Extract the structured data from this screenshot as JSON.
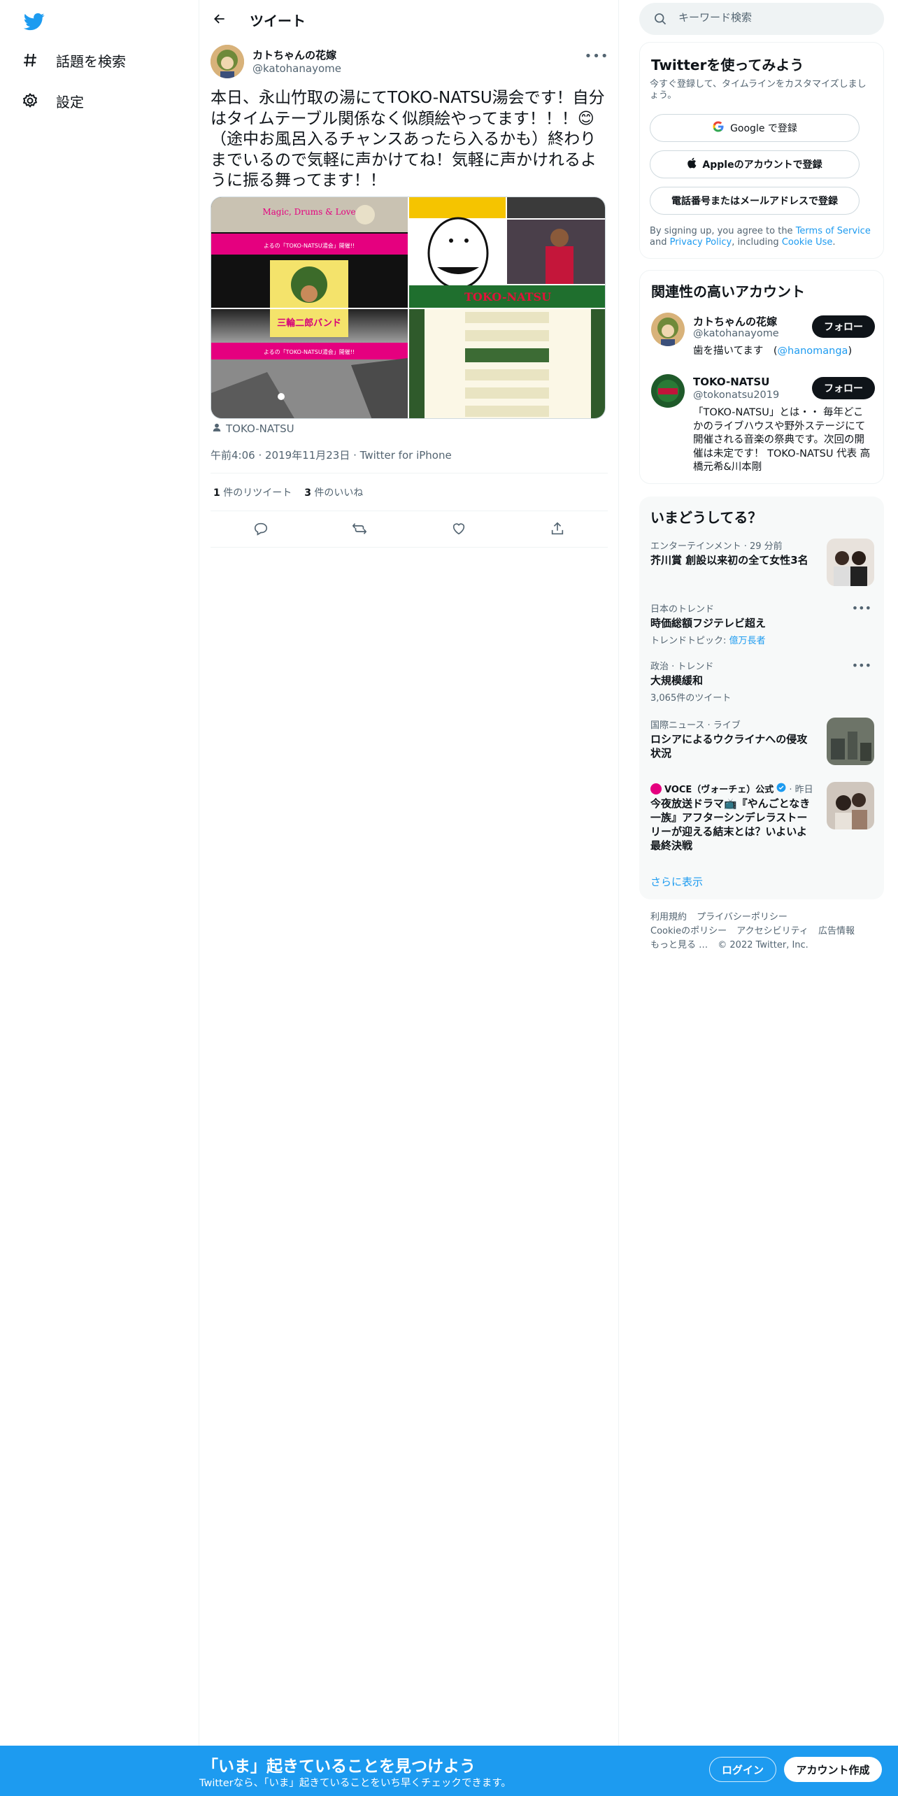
{
  "nav": {
    "logo": "twitter-bird-icon",
    "explore_label": "話題を検索",
    "settings_label": "設定"
  },
  "header": {
    "title": "ツイート"
  },
  "tweet": {
    "author_name": "カトちゃんの花嫁",
    "author_handle": "@katohanayome",
    "text": "本日、永山竹取の湯にてTOKO-NATSU湯会です！自分はタイムテーブル関係なく似顔絵やってます！！！😊（途中お風呂入るチャンスあったら入るかも）終わりまでいるので気軽に声かけてね！気軽に声かけれるように振る舞ってます！！",
    "media_tag": "TOKO-NATSU",
    "poster_line1": "Magic, Drums & Love",
    "poster_sub": "よるの「TOKO-NATSU湯会」開催!!",
    "poster_band": "三輪二郎バンド",
    "poster_sub2": "よるの「TOKO-NATSU湯会」開催!!",
    "sign_text": "TOKO-NATSU",
    "timestamp": "午前4:06 · 2019年11月23日 · Twitter for iPhone",
    "retweets_count": "1",
    "retweets_label": "件のリツイート",
    "likes_count": "3",
    "likes_label": "件のいいね"
  },
  "search": {
    "placeholder": "キーワード検索"
  },
  "signup_card": {
    "title": "Twitterを使ってみよう",
    "subtitle": "今すぐ登録して、タイムラインをカスタマイズしましょう。",
    "google_label": "Google で登録",
    "apple_label": "Appleのアカウントで登録",
    "phone_label": "電話番号またはメールアドレスで登録",
    "terms_prefix": "By signing up, you agree to the ",
    "terms_link": "Terms of Service",
    "terms_mid": " and ",
    "privacy_link": "Privacy Policy",
    "terms_mid2": ", including ",
    "cookie_link": "Cookie Use",
    "terms_end": "."
  },
  "relevant": {
    "title": "関連性の高いアカウント",
    "follow_label": "フォロー",
    "accounts": [
      {
        "name": "カトちゃんの花嫁",
        "handle": "@katohanayome",
        "bio_prefix": "歯を描いてます　(",
        "bio_link": "@hanomanga",
        "bio_suffix": ")"
      },
      {
        "name": "TOKO-NATSU",
        "handle": "@tokonatsu2019",
        "bio": "「TOKO-NATSU」とは・・ 毎年どこかのライブハウスや野外ステージにて開催される音楽の祭典です。次回の開催は未定です！ TOKO-NATSU 代表 高橋元希&川本剛"
      }
    ]
  },
  "trends": {
    "title": "いまどうしてる？",
    "items": [
      {
        "context": "エンターテインメント · 29 分前",
        "title": "芥川賞 創設以来初の全て女性3名"
      },
      {
        "context": "日本のトレンド",
        "title": "時価総額フジテレビ超え",
        "sub_prefix": "トレンドトピック: ",
        "sub_link": "億万長者"
      },
      {
        "context": "政治 · トレンド",
        "title": "大規模緩和",
        "sub": "3,065件のツイート"
      },
      {
        "context": "国際ニュース · ライブ",
        "title": "ロシアによるウクライナへの侵攻状況"
      },
      {
        "source": "VOCE（ヴォーチェ）公式",
        "time": "· 昨日",
        "title": "今夜放送ドラマ📺『やんごとなき一族』アフターシンデレラストーリーが迎える結末とは？いよいよ最終決戦"
      }
    ],
    "show_more": "さらに表示"
  },
  "footer": {
    "terms": "利用規約",
    "privacy": "プライバシーポリシー",
    "cookie": "Cookieのポリシー",
    "accessibility": "アクセシビリティ",
    "ads": "広告情報",
    "more": "もっと見る …",
    "copyright": "© 2022 Twitter, Inc."
  },
  "banner": {
    "title": "「いま」起きていることを見つけよう",
    "subtitle": "Twitterなら、「いま」起きていることをいち早くチェックできます。",
    "login": "ログイン",
    "signup": "アカウント作成"
  },
  "colors": {
    "accent": "#1d9bf0",
    "text": "#0f1419",
    "muted": "#536471",
    "border": "#eff3f4"
  }
}
